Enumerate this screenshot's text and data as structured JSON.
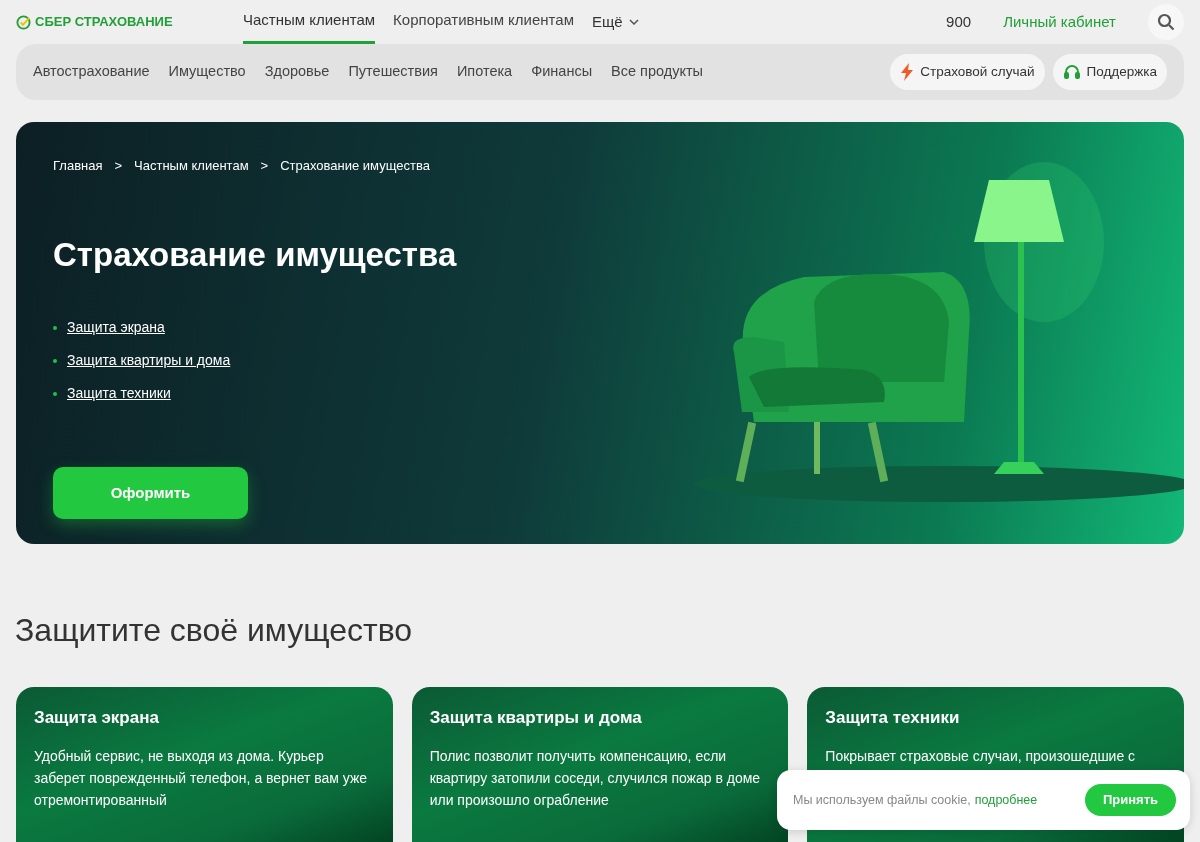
{
  "header": {
    "logo": "СБЕР СТРАХОВАНИЕ",
    "tabs": [
      {
        "label": "Частным клиентам",
        "selected": true
      },
      {
        "label": "Корпоративным клиентам",
        "selected": false
      }
    ],
    "more": "Ещё",
    "phone": "900",
    "account": "Личный кабинет"
  },
  "nav": {
    "items": [
      "Автострахование",
      "Имущество",
      "Здоровье",
      "Путешествия",
      "Ипотека",
      "Финансы",
      "Все продукты"
    ],
    "buttons": [
      {
        "kind": "claim",
        "label": "Страховой случай"
      },
      {
        "kind": "support",
        "label": "Поддержка"
      }
    ]
  },
  "hero": {
    "breadcrumbs": [
      "Главная",
      "Частным клиентам",
      "Страхование имущества"
    ],
    "separator": ">",
    "title": "Страхование имущества",
    "links": [
      "Защита экрана",
      "Защита квартиры и дома",
      "Защита техники"
    ],
    "button": "Оформить"
  },
  "section": {
    "title": "Защитите своё имущество",
    "cards": [
      {
        "title": "Защита экрана",
        "text": "Удобный сервис, не выходя из дома. Курьер заберет поврежденный телефон, а вернет вам уже отремонтированный"
      },
      {
        "title": "Защита квартиры и дома",
        "text": "Полис позволит получить компенсацию, если квартиру затопили соседи, случился пожар в доме или произошло ограбление"
      },
      {
        "title": "Защита техники",
        "text": "Покрывает страховые случаи, произошедшие с"
      }
    ]
  },
  "cookie": {
    "text": "Мы используем файлы cookie,",
    "link": "подробнее",
    "button": "Принять"
  }
}
